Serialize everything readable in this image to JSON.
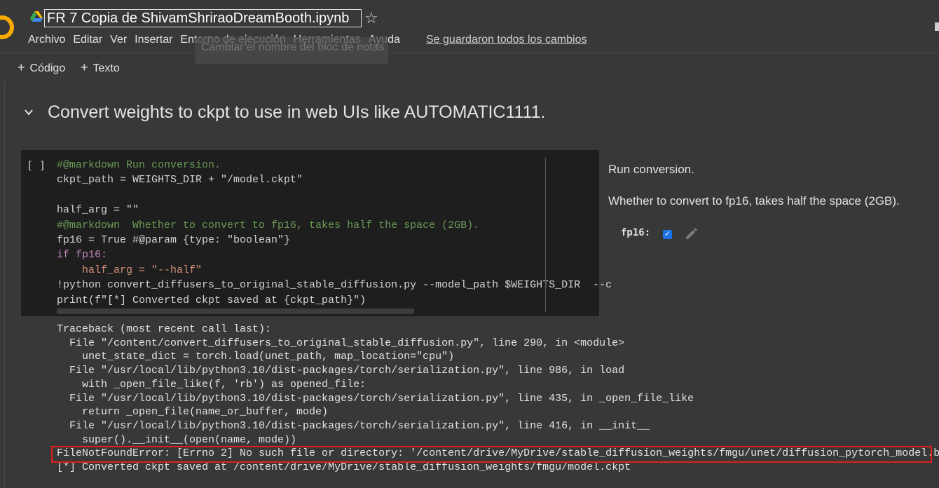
{
  "header": {
    "notebook_title": "FR 7 Copia de ShivamShriraoDreamBooth.ipynb",
    "menu": [
      "Archivo",
      "Editar",
      "Ver",
      "Insertar",
      "Entorno de ejecución",
      "Herramientas",
      "Ayuda"
    ],
    "saved_status": "Se guardaron todos los cambios",
    "tooltip": "Cambiar el nombre del bloc de notas"
  },
  "toolbar": {
    "add_code_label": "Código",
    "add_text_label": "Texto"
  },
  "section": {
    "heading": "Convert weights to ckpt to use in web UIs like AUTOMATIC1111."
  },
  "cell": {
    "run_indicator": "[ ]",
    "code_lines": [
      "#@markdown Run conversion.",
      "ckpt_path = WEIGHTS_DIR + \"/model.ckpt\"",
      "",
      "half_arg = \"\"",
      "#@markdown  Whether to convert to fp16, takes half the space (2GB).",
      "fp16 = True #@param {type: \"boolean\"}",
      "if fp16:",
      "    half_arg = \"--half\"",
      "!python convert_diffusers_to_original_stable_diffusion.py --model_path $WEIGHTS_DIR  --c",
      "print(f\"[*] Converted ckpt saved at {ckpt_path}\")"
    ],
    "form": {
      "text1": "Run conversion.",
      "text2": "Whether to convert to fp16, takes half the space (2GB).",
      "fp16_label": "fp16:",
      "fp16_checked": true
    },
    "output_lines": [
      "Traceback (most recent call last):",
      "  File \"/content/convert_diffusers_to_original_stable_diffusion.py\", line 290, in <module>",
      "    unet_state_dict = torch.load(unet_path, map_location=\"cpu\")",
      "  File \"/usr/local/lib/python3.10/dist-packages/torch/serialization.py\", line 986, in load",
      "    with _open_file_like(f, 'rb') as opened_file:",
      "  File \"/usr/local/lib/python3.10/dist-packages/torch/serialization.py\", line 435, in _open_file_like",
      "    return _open_file(name_or_buffer, mode)",
      "  File \"/usr/local/lib/python3.10/dist-packages/torch/serialization.py\", line 416, in __init__",
      "    super().__init__(open(name, mode))",
      "FileNotFoundError: [Errno 2] No such file or directory: '/content/drive/MyDrive/stable_diffusion_weights/fmgu/unet/diffusion_pytorch_model.bin'",
      "[*] Converted ckpt saved at /content/drive/MyDrive/stable_diffusion_weights/fmgu/model.ckpt"
    ]
  },
  "colors": {
    "accent_error_box": "#e01e1e",
    "checkbox": "#1a73e8",
    "logo": "#f9ab00"
  }
}
